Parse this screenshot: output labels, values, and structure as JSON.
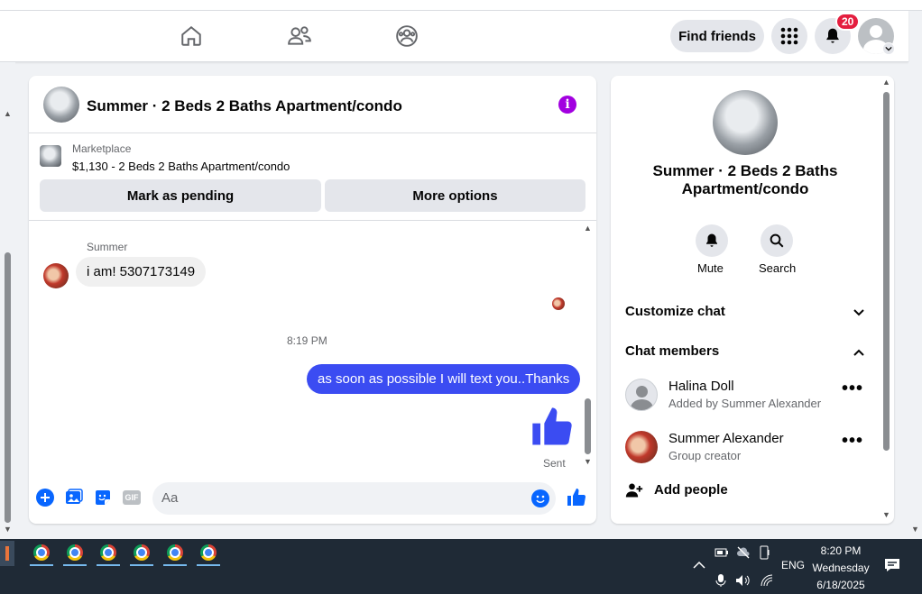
{
  "topbar": {
    "find_friends": "Find friends",
    "notifications_count": "20"
  },
  "chat": {
    "title": "Summer · 2 Beds 2 Baths Apartment/condo",
    "marketplace": {
      "label": "Marketplace",
      "listing": "$1,130 - 2 Beds 2 Baths Apartment/condo",
      "mark_pending": "Mark as pending",
      "more_options": "More options"
    },
    "messages": {
      "sender_name": "Summer",
      "incoming_text": "i am! 5307173149",
      "timestamp": "8:19 PM",
      "outgoing_text": "as soon as possible I will text you..Thanks",
      "status": "Sent"
    },
    "composer": {
      "placeholder": "Aa",
      "gif_label": "GIF"
    }
  },
  "info_panel": {
    "title": "Summer · 2 Beds 2 Baths Apartment/condo",
    "mute_label": "Mute",
    "search_label": "Search",
    "customize_chat": "Customize chat",
    "chat_members": "Chat members",
    "members": [
      {
        "name": "Halina Doll",
        "subtitle": "Added by Summer Alexander"
      },
      {
        "name": "Summer Alexander",
        "subtitle": "Group creator"
      }
    ],
    "add_people": "Add people"
  },
  "taskbar": {
    "language": "ENG",
    "time": "8:20 PM",
    "day": "Wednesday",
    "date": "6/18/2025"
  },
  "colors": {
    "accent_blue": "#0866ff",
    "outgoing_bubble": "#3b4cf2",
    "info_purple": "#a200e0",
    "badge_red": "#e41e3f"
  }
}
